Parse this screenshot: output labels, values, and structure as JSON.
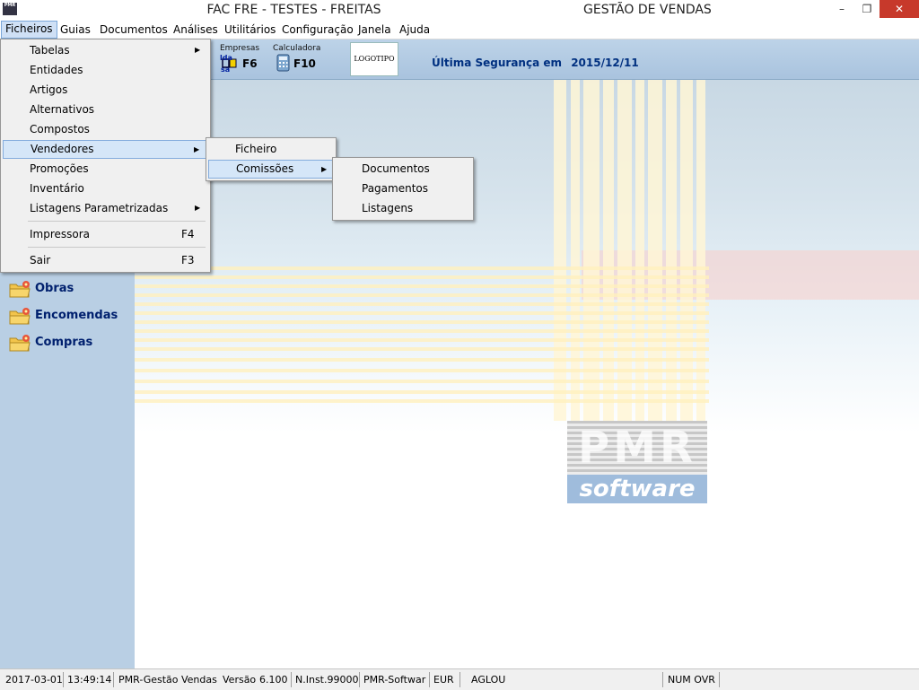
{
  "window": {
    "title": "FAC FRE - TESTES - FREITAS",
    "module": "GESTÃO DE VENDAS",
    "icon_text": "PMR",
    "controls": {
      "minimize": "–",
      "restore": "❐",
      "close": "✕"
    }
  },
  "menubar": [
    "Ficheiros",
    "Guias",
    "Documentos",
    "Análises",
    "Utilitários",
    "Configuração",
    "Janela",
    "Ajuda"
  ],
  "toolbar": {
    "empresas_caption": "Empresas",
    "empresas_key": "F6",
    "empresas_icon_text": "lda sa",
    "calc_caption": "Calculadora",
    "calc_key": "F10",
    "logo_text": "LOGOTIPO",
    "backup_label": "Última Segurança em",
    "backup_date": "2015/12/11"
  },
  "ficheiros_menu": {
    "items": [
      {
        "label": "Tabelas",
        "submenu": true
      },
      {
        "label": "Entidades"
      },
      {
        "label": "Artigos"
      },
      {
        "label": "Alternativos"
      },
      {
        "label": "Compostos"
      },
      {
        "label": "Vendedores",
        "submenu": true,
        "highlighted": true
      },
      {
        "label": "Promoções"
      },
      {
        "label": "Inventário"
      },
      {
        "label": "Listagens Parametrizadas",
        "submenu": true
      },
      {
        "label": "Impressora",
        "shortcut": "F4"
      },
      {
        "label": "Sair",
        "shortcut": "F3"
      }
    ]
  },
  "vendedores_menu": {
    "items": [
      {
        "label": "Ficheiro"
      },
      {
        "label": "Comissões",
        "submenu": true,
        "highlighted": true
      }
    ]
  },
  "comissoes_menu": {
    "items": [
      {
        "label": "Documentos"
      },
      {
        "label": "Pagamentos"
      },
      {
        "label": "Listagens"
      }
    ]
  },
  "sidebar": {
    "items": [
      {
        "label": "Obras",
        "icon": "folder-star-icon"
      },
      {
        "label": "Encomendas",
        "icon": "folder-star-icon"
      },
      {
        "label": "Compras",
        "icon": "folder-star-icon"
      }
    ]
  },
  "brand": {
    "pmr": "PMR",
    "software": "software"
  },
  "statusbar": {
    "date": "2017-03-01",
    "time": "13:49:14",
    "app": "PMR-Gestão Vendas",
    "version_label": "Versão",
    "version": "6.100",
    "inst": "N.Inst.99000",
    "vendor": "PMR-Softwar",
    "currency": "EUR",
    "user": "AGLOU",
    "keys": "NUM OVR"
  },
  "colors": {
    "sidebar_bg": "#b9cfe4",
    "toolbar_bg": "#a9c3de",
    "accent_text": "#00206e",
    "highlight": "#d5e6f8",
    "close_button": "#c7392b"
  }
}
